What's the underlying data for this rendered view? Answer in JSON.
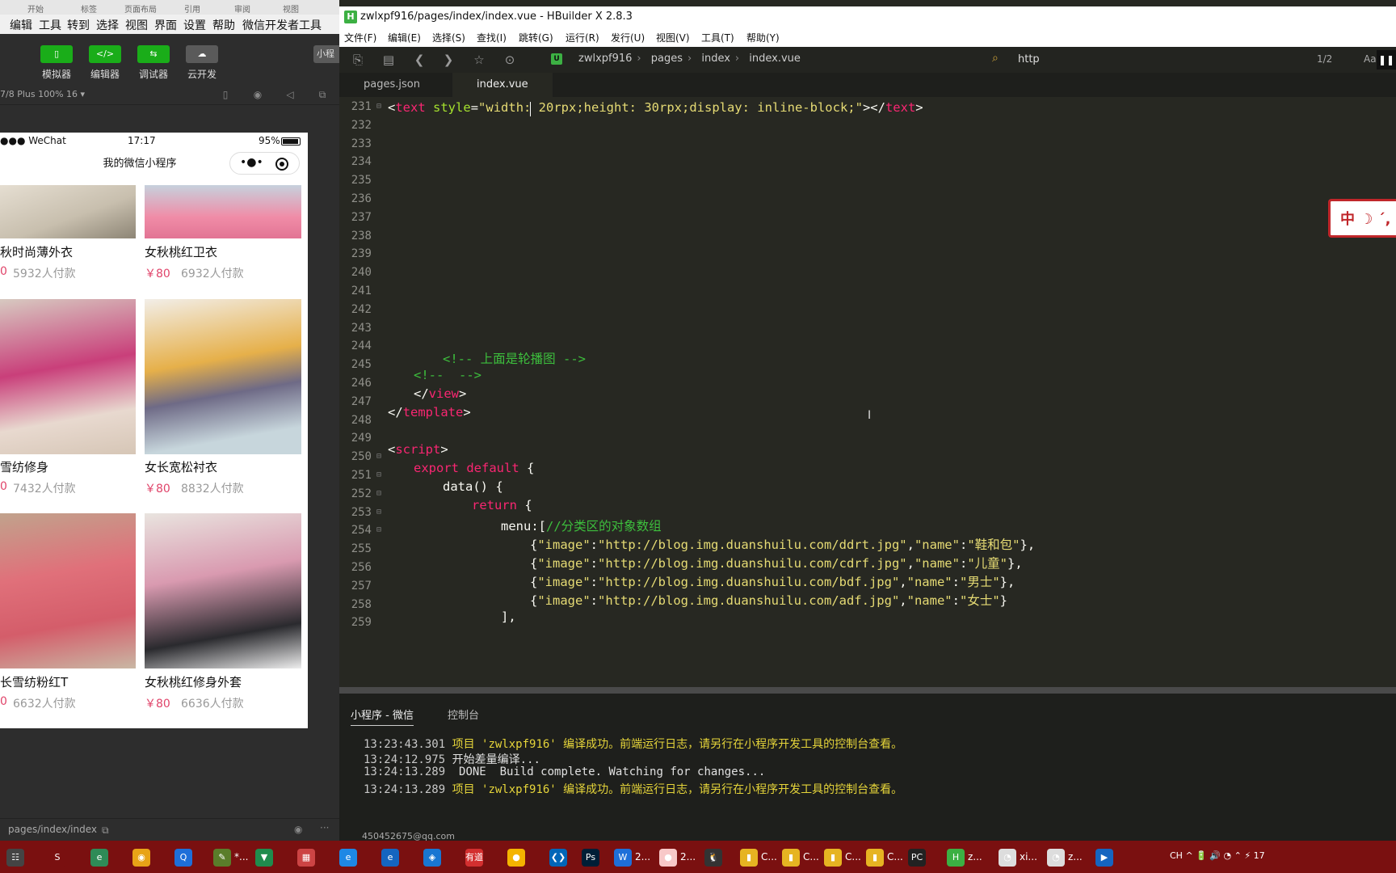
{
  "wechat": {
    "tabs": [
      "开始",
      "标签",
      "页面布局",
      "引用",
      "审阅",
      "视图"
    ],
    "menu": [
      "编辑",
      "工具",
      "转到",
      "选择",
      "视图",
      "界面",
      "设置",
      "帮助",
      "微信开发者工具"
    ],
    "tools": [
      {
        "label": "模拟器",
        "icon": "▯"
      },
      {
        "label": "编辑器",
        "icon": "</>"
      },
      {
        "label": "调试器",
        "icon": "⇆"
      },
      {
        "label": "云开发",
        "icon": "☁"
      }
    ],
    "small_button": "小程",
    "device": "7/8 Plus 100% 16 ▾",
    "phone": {
      "carrier": "●●● WeChat",
      "time": "17:17",
      "battery": "95%",
      "title": "我的微信小程序",
      "products": [
        {
          "name": "秋时尚薄外衣",
          "price": "0",
          "pay": "5932人付款"
        },
        {
          "name": "女秋桃红卫衣",
          "price": "￥80",
          "pay": "6932人付款"
        },
        {
          "name": "雪纺修身",
          "price": "0",
          "pay": "7432人付款"
        },
        {
          "name": "女长宽松衬衣",
          "price": "￥80",
          "pay": "8832人付款"
        },
        {
          "name": "长雪纺粉红T",
          "price": "0",
          "pay": "6632人付款"
        },
        {
          "name": "女秋桃红修身外套",
          "price": "￥80",
          "pay": "6636人付款"
        }
      ]
    },
    "page_path": "pages/index/index"
  },
  "hbuilder": {
    "title": "zwlxpf916/pages/index/index.vue - HBuilder X 2.8.3",
    "menu": [
      "文件(F)",
      "编辑(E)",
      "选择(S)",
      "查找(I)",
      "跳转(G)",
      "运行(R)",
      "发行(U)",
      "视图(V)",
      "工具(T)",
      "帮助(Y)"
    ],
    "breadcrumb": [
      "zwlxpf916",
      "pages",
      "index",
      "index.vue"
    ],
    "search_value": "http",
    "search_count": "1/2",
    "aa_label": "Aa",
    "tabs": [
      "pages.json",
      "index.vue"
    ],
    "active_tab": 1,
    "panel_tabs": [
      "小程序 - 微信",
      "控制台"
    ],
    "logs": [
      {
        "time": "13:23:43.301",
        "text": "项目 'zwlxpf916' 编译成功。前端运行日志，请另行在小程序开发工具的控制台查看。",
        "ok": true
      },
      {
        "time": "13:24:12.975",
        "text": "开始差量编译...",
        "ok": false
      },
      {
        "time": "13:24:13.289",
        "text": " DONE  Build complete. Watching for changes...",
        "ok": false
      },
      {
        "time": "13:24:13.289",
        "text": "项目 'zwlxpf916' 编译成功。前端运行日志，请另行在小程序开发工具的控制台查看。",
        "ok": true
      }
    ],
    "status_text": "450452675@qq.com",
    "code": {
      "line_numbers": [
        "231",
        "232",
        "233",
        "234",
        "235",
        "236",
        "237",
        "238",
        "239",
        "240",
        "241",
        "242",
        "243",
        "244",
        "245",
        "246",
        "247",
        "248",
        "249",
        "250",
        "251",
        "252",
        "253",
        "254",
        "255",
        "256",
        "257",
        "258",
        "259"
      ],
      "l231": {
        "lt": "<",
        "tag": "text",
        "sp": " ",
        "attr": "style",
        "eq": "=",
        "val": "\"width: 20rpx;height: 30rpx;display: inline-block;\"",
        "mid": "></",
        "tag2": "text",
        "gt": ">"
      },
      "l245": "<!-- 上面是轮播图 -->",
      "l246": "<!--  -->",
      "l247": {
        "open": "</",
        "tag": "view",
        "close": ">"
      },
      "l248": {
        "open": "</",
        "tag": "template",
        "close": ">"
      },
      "l250": {
        "open": "<",
        "tag": "script",
        "close": ">"
      },
      "l251": {
        "kw": "export default",
        "rest": " {"
      },
      "l252": "data() {",
      "l253": {
        "kw": "return",
        "rest": " {"
      },
      "l254": {
        "key": "menu:[",
        "comment": "//分类区的对象数组"
      },
      "menu_items": [
        {
          "image": "http://blog.img.duanshuilu.com/ddrt.jpg",
          "name": "鞋和包",
          "tail": "},"
        },
        {
          "image": "http://blog.img.duanshuilu.com/cdrf.jpg",
          "name": "儿童",
          "tail": "},"
        },
        {
          "image": "http://blog.img.duanshuilu.com/bdf.jpg",
          "name": "男士",
          "tail": "},"
        },
        {
          "image": "http://blog.img.duanshuilu.com/adf.jpg",
          "name": "女士",
          "tail": "}"
        }
      ],
      "l259": "],"
    },
    "seal_text": "中 ☽ ˊ,"
  },
  "taskbar": {
    "items": [
      {
        "label": "",
        "color": "#444",
        "icon": "☷"
      },
      {
        "label": "",
        "color": "#7a1010",
        "icon": "S"
      },
      {
        "label": "",
        "color": "#2e8b57",
        "icon": "e"
      },
      {
        "label": "",
        "color": "#e8a317",
        "icon": "◉"
      },
      {
        "label": "",
        "color": "#1e6fd9",
        "icon": "Q"
      },
      {
        "label": "*...",
        "color": "#5a7d2a",
        "icon": "✎"
      },
      {
        "label": "",
        "color": "#1f8c4d",
        "icon": "▼"
      },
      {
        "label": "",
        "color": "#c44",
        "icon": "▦"
      },
      {
        "label": "",
        "color": "#1e88e5",
        "icon": "e"
      },
      {
        "label": "",
        "color": "#1565c0",
        "icon": "e"
      },
      {
        "label": "",
        "color": "#1976d2",
        "icon": "◈"
      },
      {
        "label": "",
        "color": "#d32f2f",
        "icon": "有道"
      },
      {
        "label": "",
        "color": "#f4b400",
        "icon": "●"
      },
      {
        "label": "",
        "color": "#0066b8",
        "icon": "❮❯"
      },
      {
        "label": "",
        "color": "#001e36",
        "icon": "Ps"
      },
      {
        "label": "2...",
        "color": "#1e6fd9",
        "icon": "W"
      },
      {
        "label": "2...",
        "color": "#f8c8c8",
        "icon": "●"
      },
      {
        "label": "",
        "color": "#333",
        "icon": "🐧"
      },
      {
        "label": "C...",
        "color": "#e6b422",
        "icon": "▮"
      },
      {
        "label": "C...",
        "color": "#e6b422",
        "icon": "▮"
      },
      {
        "label": "C...",
        "color": "#e6b422",
        "icon": "▮"
      },
      {
        "label": "C...",
        "color": "#e6b422",
        "icon": "▮"
      },
      {
        "label": "",
        "color": "#222",
        "icon": "PC"
      },
      {
        "label": "z...",
        "color": "#3cb043",
        "icon": "H"
      },
      {
        "label": "xi...",
        "color": "#ddd",
        "icon": "◔"
      },
      {
        "label": "z...",
        "color": "#ddd",
        "icon": "◔"
      },
      {
        "label": "",
        "color": "#1565c0",
        "icon": "▶"
      }
    ],
    "tray": "CH  ^  🔋  🔊  ◔  ⌃  ⚡  17"
  },
  "colors": {
    "editor_bg": "#272822",
    "tag": "#f92672",
    "attr": "#a6e22e",
    "string": "#e6db74",
    "comment": "#3dbf3d",
    "price": "#e0446a",
    "accent_green": "#1aad19",
    "taskbar": "#7a1010"
  }
}
